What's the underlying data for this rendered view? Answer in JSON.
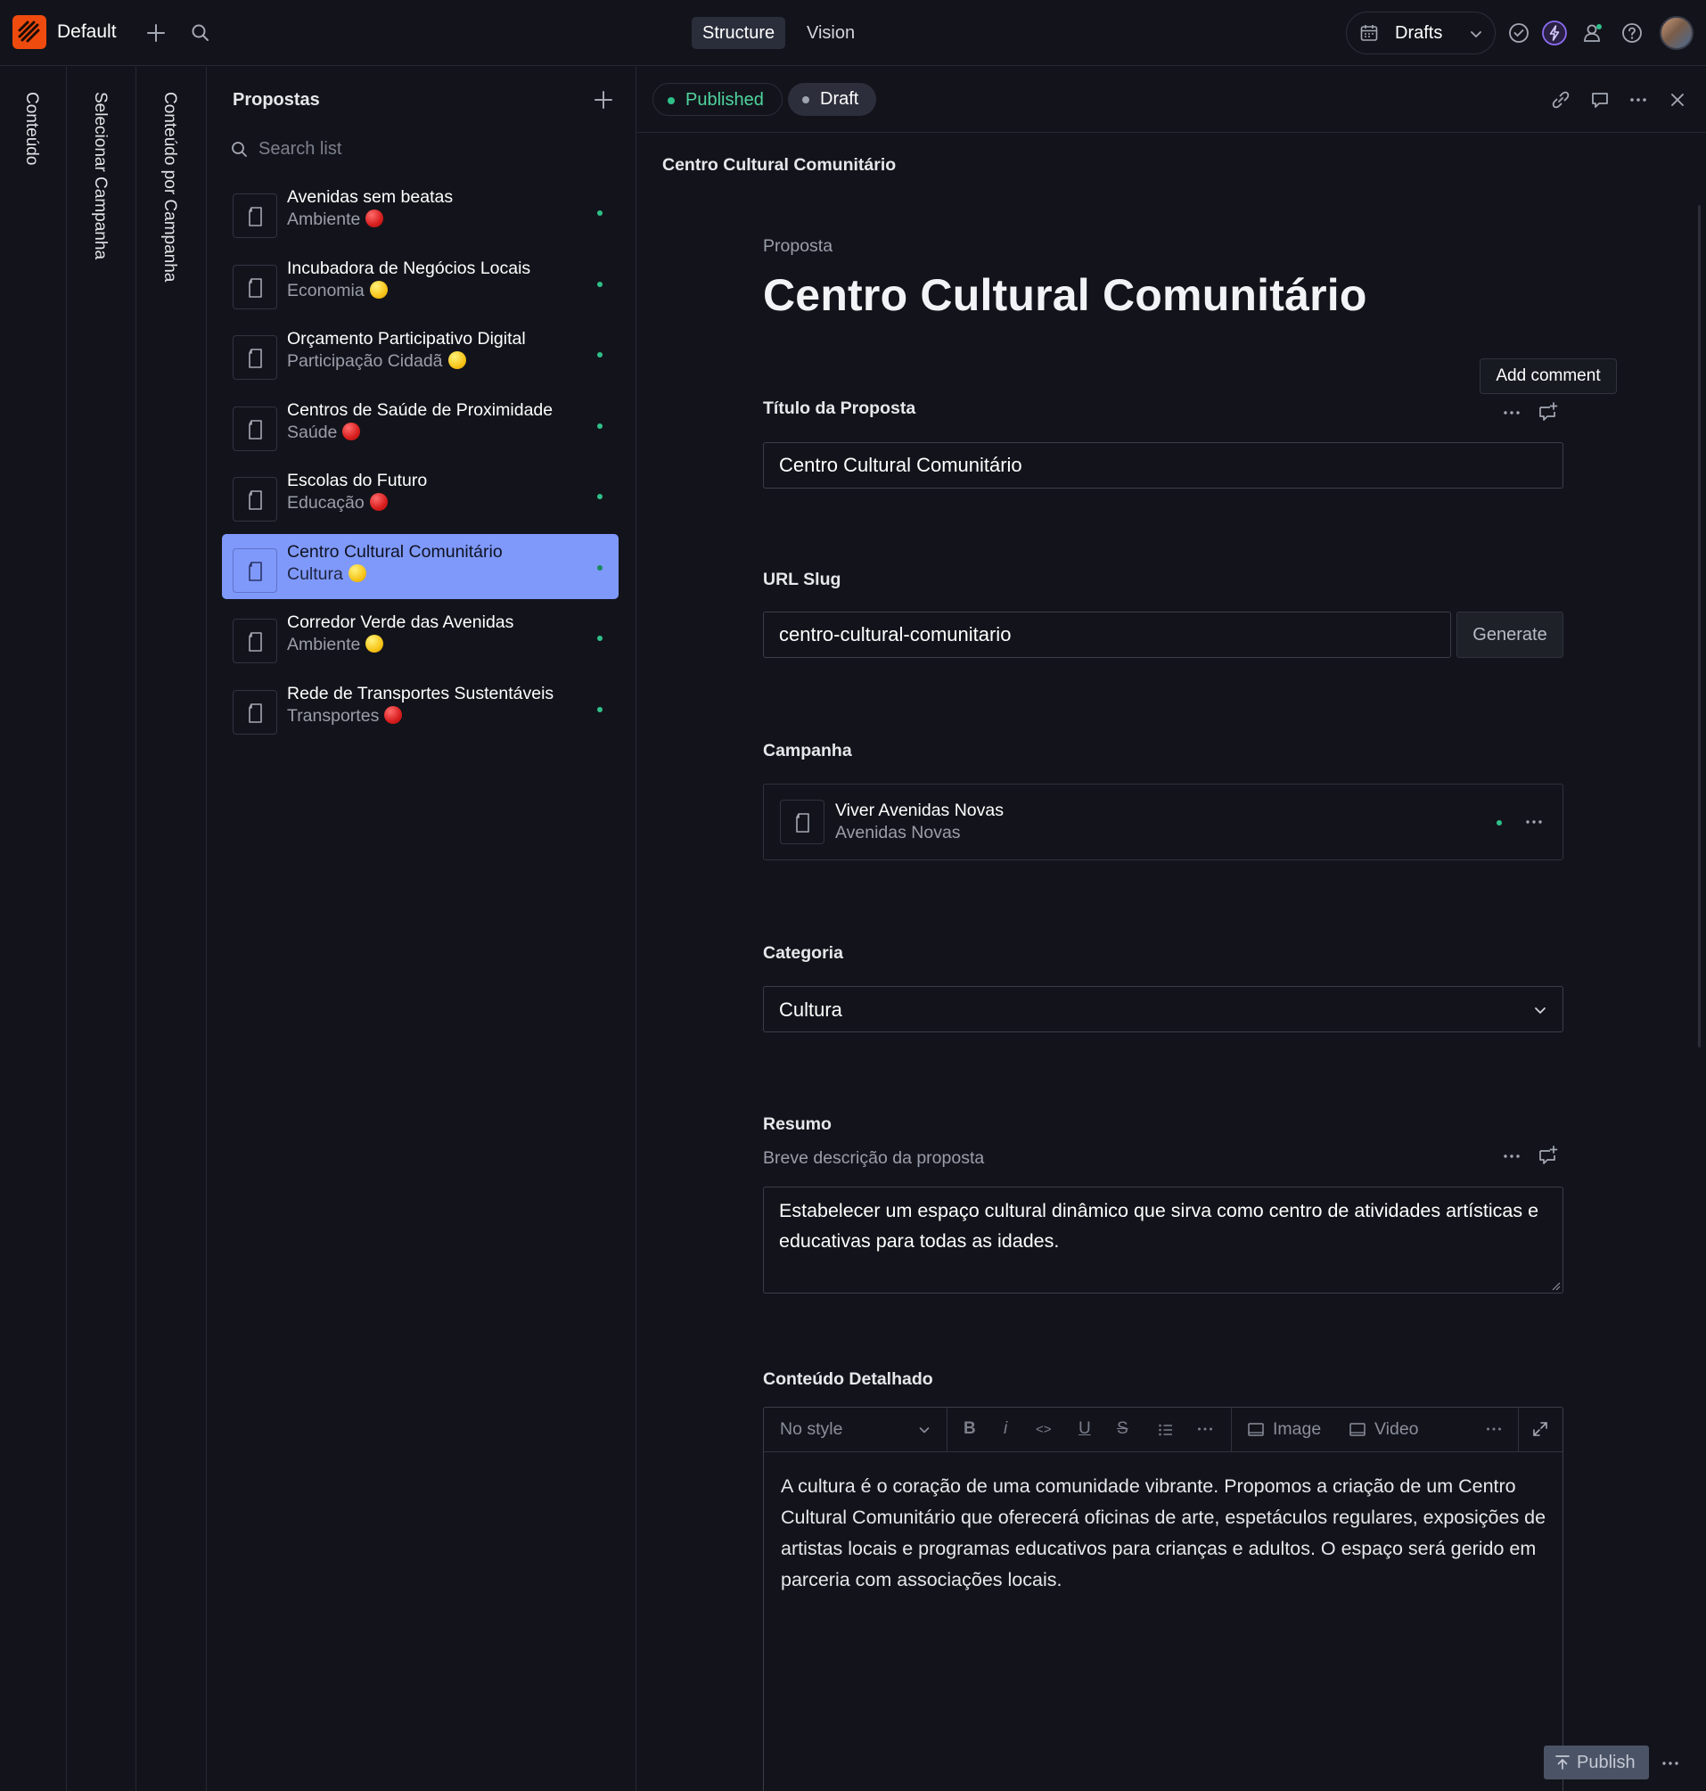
{
  "topbar": {
    "workspace": "Default",
    "tools": [
      "Structure",
      "Vision"
    ],
    "active_tool": "Structure",
    "release_label": "Drafts",
    "icons": [
      "add-icon",
      "search-icon",
      "calendar-icon",
      "check-circle-icon",
      "bolt-icon",
      "users-icon",
      "help-icon"
    ]
  },
  "panes": {
    "collapsed": [
      "Conteúdo",
      "Selecionar Campanha",
      "Conteúdo por Campanha"
    ]
  },
  "list": {
    "title": "Propostas",
    "search_placeholder": "Search list",
    "items": [
      {
        "title": "Avenidas sem beatas",
        "subtitle": "Ambiente",
        "emoji": "red"
      },
      {
        "title": "Incubadora de Negócios Locais",
        "subtitle": "Economia",
        "emoji": "yellow"
      },
      {
        "title": "Orçamento Participativo Digital",
        "subtitle": "Participação Cidadã",
        "emoji": "yellow"
      },
      {
        "title": "Centros de Saúde de Proximidade",
        "subtitle": "Saúde",
        "emoji": "red"
      },
      {
        "title": "Escolas do Futuro",
        "subtitle": "Educação",
        "emoji": "red"
      },
      {
        "title": "Centro Cultural Comunitário",
        "subtitle": "Cultura",
        "emoji": "yellow",
        "selected": true
      },
      {
        "title": "Corredor Verde das Avenidas",
        "subtitle": "Ambiente",
        "emoji": "yellow"
      },
      {
        "title": "Rede de Transportes Sustentáveis",
        "subtitle": "Transportes",
        "emoji": "red"
      }
    ]
  },
  "document": {
    "status_published": "Published",
    "status_draft": "Draft",
    "breadcrumb": "Centro Cultural Comunitário",
    "type_label": "Proposta",
    "title": "Centro Cultural Comunitário",
    "tooltip": "Add comment",
    "fields": {
      "titulo": {
        "label": "Título da Proposta",
        "value": "Centro Cultural Comunitário"
      },
      "slug": {
        "label": "URL Slug",
        "value": "centro-cultural-comunitario",
        "button": "Generate"
      },
      "campanha": {
        "label": "Campanha",
        "ref_title": "Viver Avenidas Novas",
        "ref_subtitle": "Avenidas Novas"
      },
      "categoria": {
        "label": "Categoria",
        "value": "Cultura"
      },
      "resumo": {
        "label": "Resumo",
        "description": "Breve descrição da proposta",
        "value": "Estabelecer um espaço cultural dinâmico que sirva como centro de atividades artísticas e educativas para todas as idades."
      },
      "conteudo": {
        "label": "Conteúdo Detalhado",
        "style_select": "No style",
        "toolbar": [
          "B",
          "I",
          "<>",
          "U",
          "S"
        ],
        "image_label": "Image",
        "video_label": "Video",
        "body": "A cultura é o coração de uma comunidade vibrante. Propomos a criação de um Centro Cultural Comunitário que oferecerá oficinas de arte, espetáculos regulares, exposições de artistas locais e programas educativos para crianças e adultos. O espaço será gerido em parceria com associações locais."
      }
    },
    "publish_label": "Publish"
  },
  "colors": {
    "background": "#13141b",
    "accent_selected": "#7f99fb",
    "published_green": "#2fc08a",
    "brand_orange": "#f04b0f"
  }
}
